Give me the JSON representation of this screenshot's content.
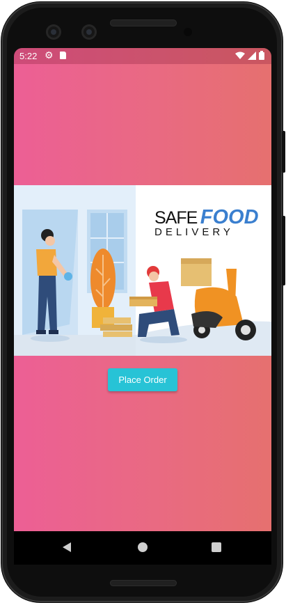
{
  "status_bar": {
    "time": "5:22",
    "icons": [
      "gear-icon",
      "sd-card-icon",
      "wifi-icon",
      "signal-icon",
      "battery-icon"
    ]
  },
  "banner": {
    "title_safe": "SAFE",
    "title_food": "FOOD",
    "title_delivery": "DELIVERY"
  },
  "main": {
    "place_order_label": "Place Order"
  },
  "nav_bar": {
    "icons": [
      "back-icon",
      "home-icon",
      "recents-icon"
    ]
  },
  "colors": {
    "gradient_start": "#ec5f95",
    "gradient_end": "#e6706f",
    "button": "#27c3d6",
    "food_text": "#3a7fcf",
    "scooter": "#f09223"
  }
}
